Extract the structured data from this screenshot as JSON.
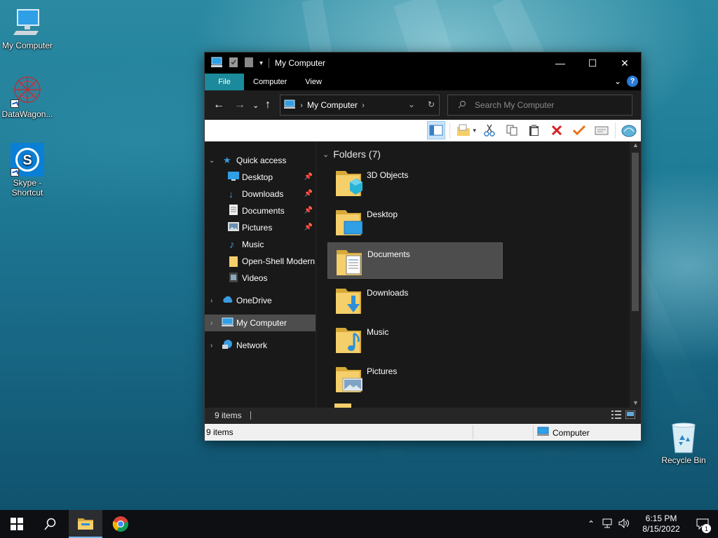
{
  "desktop": {
    "icons": [
      {
        "label": "My Computer"
      },
      {
        "label": "DataWagon..."
      },
      {
        "label": "Skype - Shortcut"
      },
      {
        "label": "Recycle Bin"
      }
    ]
  },
  "window": {
    "title": "My Computer",
    "controls": {
      "minimize": "—",
      "maximize": "☐",
      "close": "✕"
    },
    "ribbon_tabs": [
      "File",
      "Computer",
      "View"
    ],
    "address": {
      "location": "My Computer"
    },
    "search": {
      "placeholder": "Search My Computer"
    },
    "nav_pane": {
      "quick_access": "Quick access",
      "quick_items": [
        {
          "label": "Desktop",
          "pinned": true
        },
        {
          "label": "Downloads",
          "pinned": true
        },
        {
          "label": "Documents",
          "pinned": true
        },
        {
          "label": "Pictures",
          "pinned": true
        },
        {
          "label": "Music",
          "pinned": false
        },
        {
          "label": "Open-Shell Modern",
          "pinned": false
        },
        {
          "label": "Videos",
          "pinned": false
        }
      ],
      "onedrive": "OneDrive",
      "my_computer": "My Computer",
      "network": "Network"
    },
    "content": {
      "group_header": "Folders (7)",
      "folders": [
        {
          "name": "3D Objects",
          "selected": false
        },
        {
          "name": "Desktop",
          "selected": false
        },
        {
          "name": "Documents",
          "selected": true
        },
        {
          "name": "Downloads",
          "selected": false
        },
        {
          "name": "Music",
          "selected": false
        },
        {
          "name": "Pictures",
          "selected": false
        }
      ]
    },
    "status_bar": {
      "item_count": "9 items"
    },
    "classic_status": {
      "item_count": "9 items",
      "zone": "Computer"
    }
  },
  "taskbar": {
    "time": "6:15 PM",
    "date": "8/15/2022",
    "notification_count": "1"
  },
  "colors": {
    "accent": "#1a8a9c",
    "selection": "#4d4d4d",
    "folder": "#f5cf6a"
  }
}
